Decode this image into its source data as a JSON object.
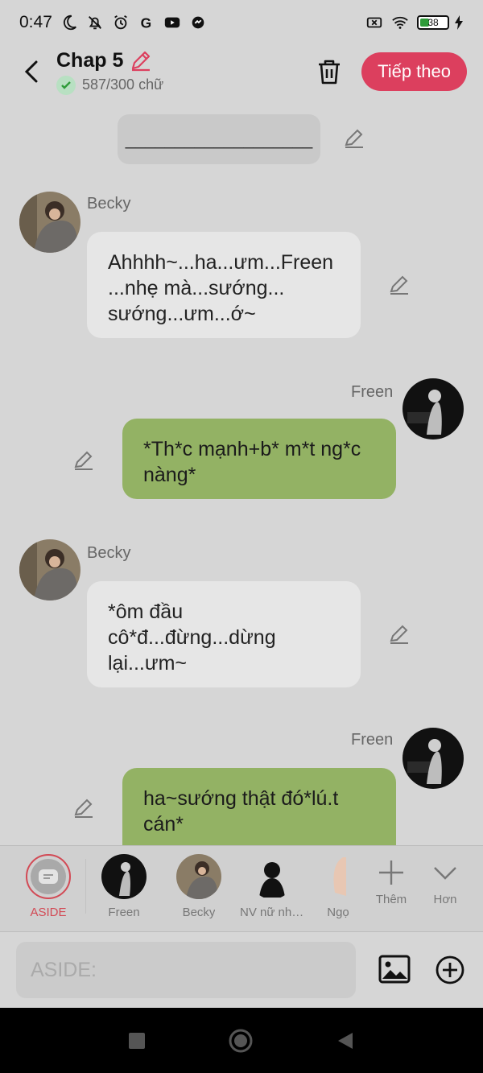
{
  "status": {
    "time": "0:47",
    "battery": "38"
  },
  "header": {
    "title": "Chap 5",
    "word_count": "587/300 chữ",
    "next_label": "Tiếp theo"
  },
  "chat": {
    "divider": "___________________",
    "messages": [
      {
        "speaker": "Becky",
        "text": "Ahhhh~...ha...ưm...Freen ...nhẹ mà...sướng... sướng...ưm...ớ~"
      },
      {
        "speaker": "Freen",
        "text": "*Th*c mạnh+b* m*t ng*c nàng*"
      },
      {
        "speaker": "Becky",
        "text": "*ôm đầu cô*đ...đừng...dừng lại...ưm~"
      },
      {
        "speaker": "Freen",
        "text": "ha~sướng thật đó*lú.t cán*"
      }
    ]
  },
  "characters": {
    "aside": "ASIDE",
    "items": [
      "Freen",
      "Becky",
      "NV nữ nhi...",
      "Ngọ"
    ],
    "more": "Thêm",
    "less": "Hơn"
  },
  "composer": {
    "placeholder": "ASIDE:"
  },
  "colors": {
    "accent": "#dc3f5e",
    "right_bubble": "#93b264",
    "left_bubble": "#e6e6e6"
  }
}
